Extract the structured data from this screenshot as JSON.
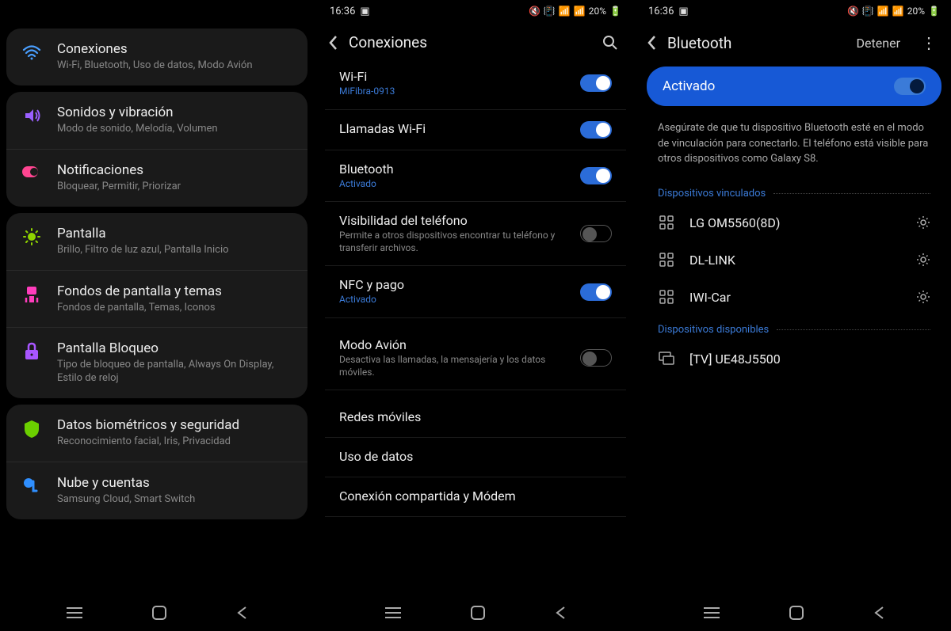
{
  "status": {
    "time": "16:36",
    "battery": "20%"
  },
  "screen1": {
    "groups": [
      [
        {
          "icon": "wifi",
          "title": "Conexiones",
          "sub": "Wi-Fi, Bluetooth, Uso de datos, Modo Avión"
        }
      ],
      [
        {
          "icon": "sound",
          "title": "Sonidos y vibración",
          "sub": "Modo de sonido, Melodía, Volumen"
        },
        {
          "icon": "notif",
          "title": "Notificaciones",
          "sub": "Bloquear, Permitir, Priorizar"
        }
      ],
      [
        {
          "icon": "display",
          "title": "Pantalla",
          "sub": "Brillo, Filtro de luz azul, Pantalla Inicio"
        },
        {
          "icon": "wall",
          "title": "Fondos de pantalla y temas",
          "sub": "Fondos de pantalla, Temas, Iconos"
        },
        {
          "icon": "lock",
          "title": "Pantalla Bloqueo",
          "sub": "Tipo de bloqueo de pantalla, Always On Display, Estilo de reloj"
        }
      ],
      [
        {
          "icon": "bio",
          "title": "Datos biométricos y seguridad",
          "sub": "Reconocimiento facial, Iris, Privacidad"
        },
        {
          "icon": "cloud",
          "title": "Nube y cuentas",
          "sub": "Samsung Cloud, Smart Switch"
        }
      ]
    ]
  },
  "screen2": {
    "header": "Conexiones",
    "items": [
      {
        "title": "Wi-Fi",
        "sub": "MiFibra-0913",
        "subActive": true,
        "toggle": "on"
      },
      {
        "title": "Llamadas Wi-Fi",
        "toggle": "on"
      },
      {
        "title": "Bluetooth",
        "sub": "Activado",
        "subActive": true,
        "toggle": "on"
      },
      {
        "title": "Visibilidad del teléfono",
        "sub": "Permite a otros dispositivos encontrar tu teléfono y transferir archivos.",
        "toggle": "off"
      },
      {
        "title": "NFC y pago",
        "sub": "Activado",
        "subActive": true,
        "toggle": "on",
        "gapAfter": true
      },
      {
        "title": "Modo Avión",
        "sub": "Desactiva las llamadas, la mensajería y los datos móviles.",
        "toggle": "off",
        "gapAfter": true
      },
      {
        "title": "Redes móviles"
      },
      {
        "title": "Uso de datos"
      },
      {
        "title": "Conexión compartida y Módem"
      }
    ]
  },
  "screen3": {
    "header": "Bluetooth",
    "stop": "Detener",
    "activeLabel": "Activado",
    "desc": "Asegúrate de que tu dispositivo Bluetooth esté en el modo de vinculación para conectarlo. El teléfono está visible para otros dispositivos como Galaxy S8.",
    "pairedLabel": "Dispositivos vinculados",
    "paired": [
      {
        "name": "LG OM5560(8D)",
        "icon": "grid"
      },
      {
        "name": "DL-LINK",
        "icon": "grid"
      },
      {
        "name": "IWI-Car",
        "icon": "grid"
      }
    ],
    "availLabel": "Dispositivos disponibles",
    "available": [
      {
        "name": "[TV] UE48J5500",
        "icon": "tv"
      }
    ]
  }
}
